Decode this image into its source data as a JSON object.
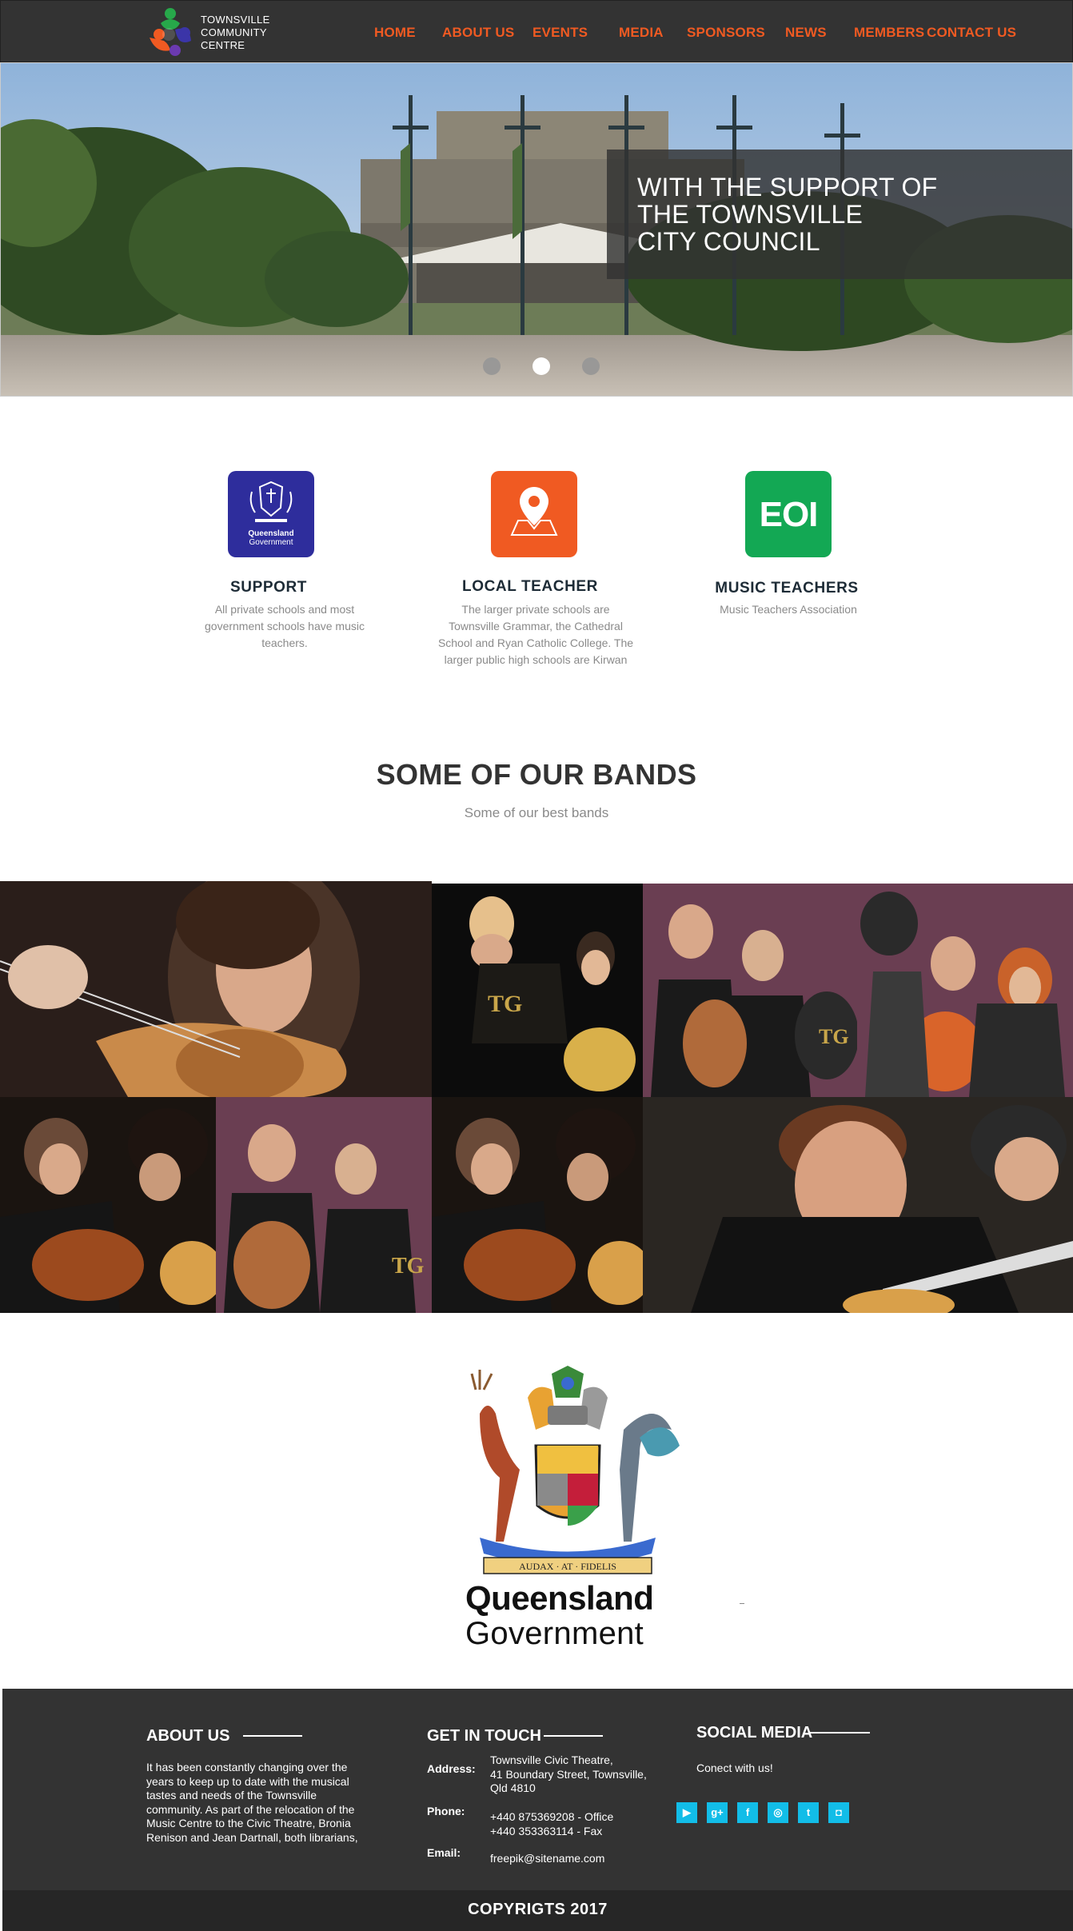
{
  "header": {
    "logo_text": [
      "TOWNSVILLE",
      "COMMUNITY",
      "CENTRE"
    ],
    "nav": [
      "HOME",
      "ABOUT US",
      "EVENTS",
      "MEDIA",
      "SPONSORS",
      "NEWS",
      "MEMBERS",
      "CONTACT US"
    ]
  },
  "hero": {
    "title_lines": [
      "WITH THE SUPPORT OF",
      "THE TOWNSVILLE",
      "CITY COUNCIL"
    ],
    "slides": 3,
    "active_slide": 2
  },
  "features": [
    {
      "icon": "queensland-government-icon",
      "icon_text": [
        "Queensland",
        "Government"
      ],
      "title": "SUPPORT",
      "desc": [
        "All private schools and most",
        "government schools have music",
        "teachers."
      ],
      "color": "#2e2d9c"
    },
    {
      "icon": "map-pin-icon",
      "title": "LOCAL TEACHER",
      "desc": [
        "The larger private schools are",
        "Townsville Grammar, the Cathedral",
        "School and Ryan Catholic College. The",
        "larger public high schools are Kirwan"
      ],
      "color": "#f05a22"
    },
    {
      "icon": "eoi-icon",
      "icon_text": [
        "EOI"
      ],
      "title": "MUSIC TEACHERS",
      "desc": [
        "Music Teachers Association"
      ],
      "color": "#13a854"
    }
  ],
  "bands": {
    "title": "SOME OF OUR BANDS",
    "subtitle": "Some of our best bands",
    "photos": 8
  },
  "partner_logo": {
    "motto": "AUDAX · AT · FIDELIS",
    "line1": "Queensland",
    "line2": "Government"
  },
  "footer": {
    "about": {
      "title": "ABOUT US",
      "text": [
        "It has been constantly changing over the",
        "years to keep up to date with the musical",
        "tastes and needs of the Townsville",
        "community. As part of the relocation of the",
        "Music Centre to the Civic Theatre, Bronia",
        "Renison and Jean Dartnall, both librarians,"
      ]
    },
    "contact": {
      "title": "GET IN TOUCH",
      "address_label": "Address:",
      "address": [
        "Townsville Civic Theatre,",
        "41 Boundary Street, Townsville,",
        "Qld 4810"
      ],
      "phone_label": "Phone:",
      "phone": [
        "+440 875369208 - Office",
        "+440 353363114 - Fax"
      ],
      "email_label": "Email:",
      "email": "freepik@sitename.com"
    },
    "social": {
      "title": "SOCIAL MEDIA",
      "text": "Conect with us!",
      "icons": [
        {
          "name": "youtube-icon",
          "glyph": "▶"
        },
        {
          "name": "google-plus-icon",
          "glyph": "g+"
        },
        {
          "name": "facebook-icon",
          "glyph": "f"
        },
        {
          "name": "dribbble-icon",
          "glyph": "◎"
        },
        {
          "name": "twitter-icon",
          "glyph": "t"
        },
        {
          "name": "instagram-icon",
          "glyph": "◘"
        }
      ]
    },
    "copyright": "COPYRIGTS 2017"
  },
  "colors": {
    "accent": "#f05a22",
    "dark": "#333333",
    "social": "#12bde8"
  }
}
